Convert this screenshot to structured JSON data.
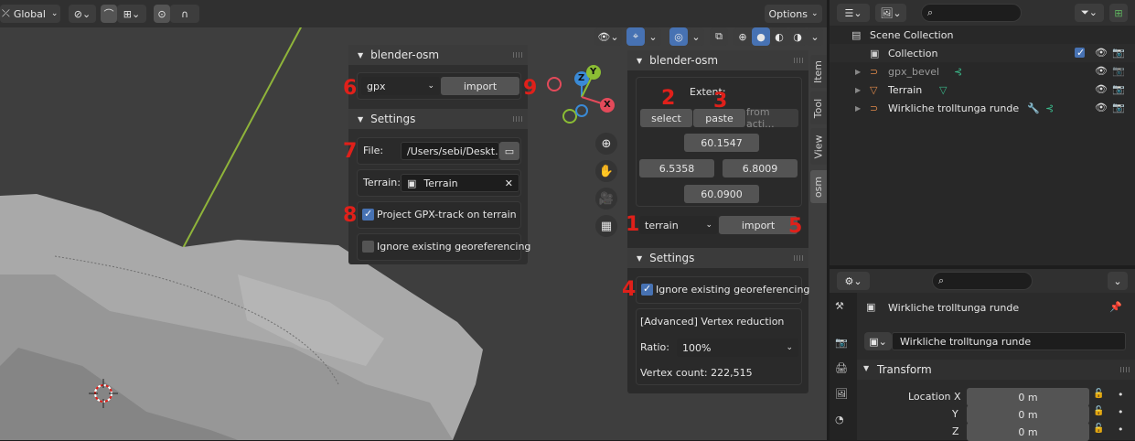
{
  "viewport_header": {
    "transform_orientation": "Global",
    "options_label": "Options"
  },
  "osm_import_panel": {
    "title": "blender-osm",
    "source_value": "gpx",
    "import_label": "import",
    "settings_title": "Settings",
    "file_label": "File:",
    "file_value": "/Users/sebi/Deskt...",
    "terrain_label": "Terrain:",
    "terrain_value": "Terrain",
    "project_gpx_label": "Project GPX-track on terrain",
    "project_gpx_checked": true,
    "ignore_georef_label": "Ignore existing georeferencing",
    "ignore_georef_checked": false
  },
  "sidebar_panel": {
    "title": "blender-osm",
    "extent_label": "Extent:",
    "select_label": "select",
    "paste_label": "paste",
    "from_active_label": "from acti...",
    "extent_top": "60.1547",
    "extent_left": "6.5358",
    "extent_right": "6.8009",
    "extent_bottom": "60.0900",
    "source_value": "terrain",
    "import_label": "import",
    "settings_title": "Settings",
    "ignore_georef_label": "Ignore existing georeferencing",
    "ignore_georef_checked": true,
    "vertex_reduction_label": "[Advanced] Vertex reduction",
    "ratio_label": "Ratio:",
    "ratio_value": "100%",
    "vertex_count_label": "Vertex count: 222,515"
  },
  "sidebar_tabs": [
    "Item",
    "Tool",
    "View",
    "osm"
  ],
  "annotations": [
    "1",
    "2",
    "3",
    "4",
    "5",
    "6",
    "7",
    "8",
    "9"
  ],
  "gizmo": {
    "x": "X",
    "y": "Y",
    "z": "Z"
  },
  "outliner": {
    "scene_collection": "Scene Collection",
    "items": [
      {
        "label": "Collection"
      },
      {
        "label": "gpx_bevel"
      },
      {
        "label": "Terrain"
      },
      {
        "label": "Wirkliche trolltunga runde"
      }
    ]
  },
  "properties": {
    "object_name": "Wirkliche trolltunga runde",
    "object_field": "Wirkliche trolltunga runde",
    "transform_title": "Transform",
    "location_x_label": "Location X",
    "location_y_label": "Y",
    "location_z_label": "Z",
    "location_x": "0 m",
    "location_y": "0 m",
    "location_z": "0 m"
  },
  "colors": {
    "accent_blue": "#4772b3",
    "annotation_red": "#e0201a",
    "axis_x": "#e34a5a",
    "axis_y": "#8bbd34",
    "axis_z": "#3a8ad6"
  }
}
